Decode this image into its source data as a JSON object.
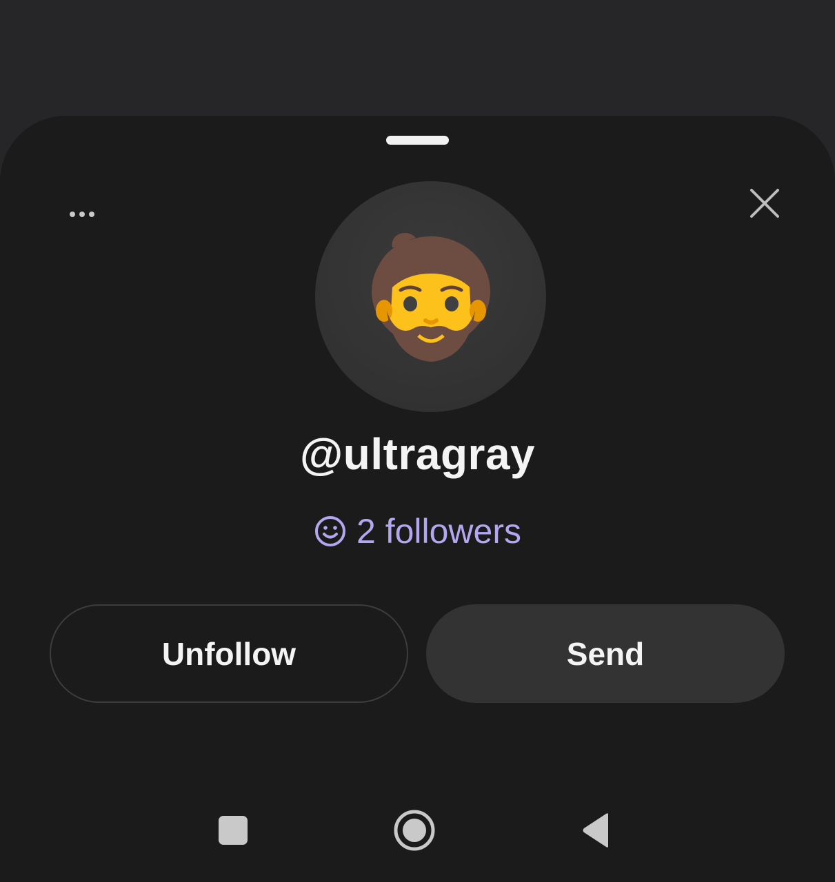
{
  "profile": {
    "username": "@ultragray",
    "followers_text": "2 followers",
    "avatar_icon": "bearded-man-emoji"
  },
  "actions": {
    "unfollow_label": "Unfollow",
    "send_label": "Send"
  },
  "icons": {
    "more": "more-horizontal-icon",
    "close": "close-icon",
    "followers": "smiley-icon"
  },
  "navbar": {
    "recents": "recents-square-icon",
    "home": "home-circle-icon",
    "back": "back-triangle-icon"
  },
  "colors": {
    "background": "#262628",
    "sheet": "#1b1b1b",
    "accent": "#b3a8ef",
    "send_button": "#333333"
  }
}
